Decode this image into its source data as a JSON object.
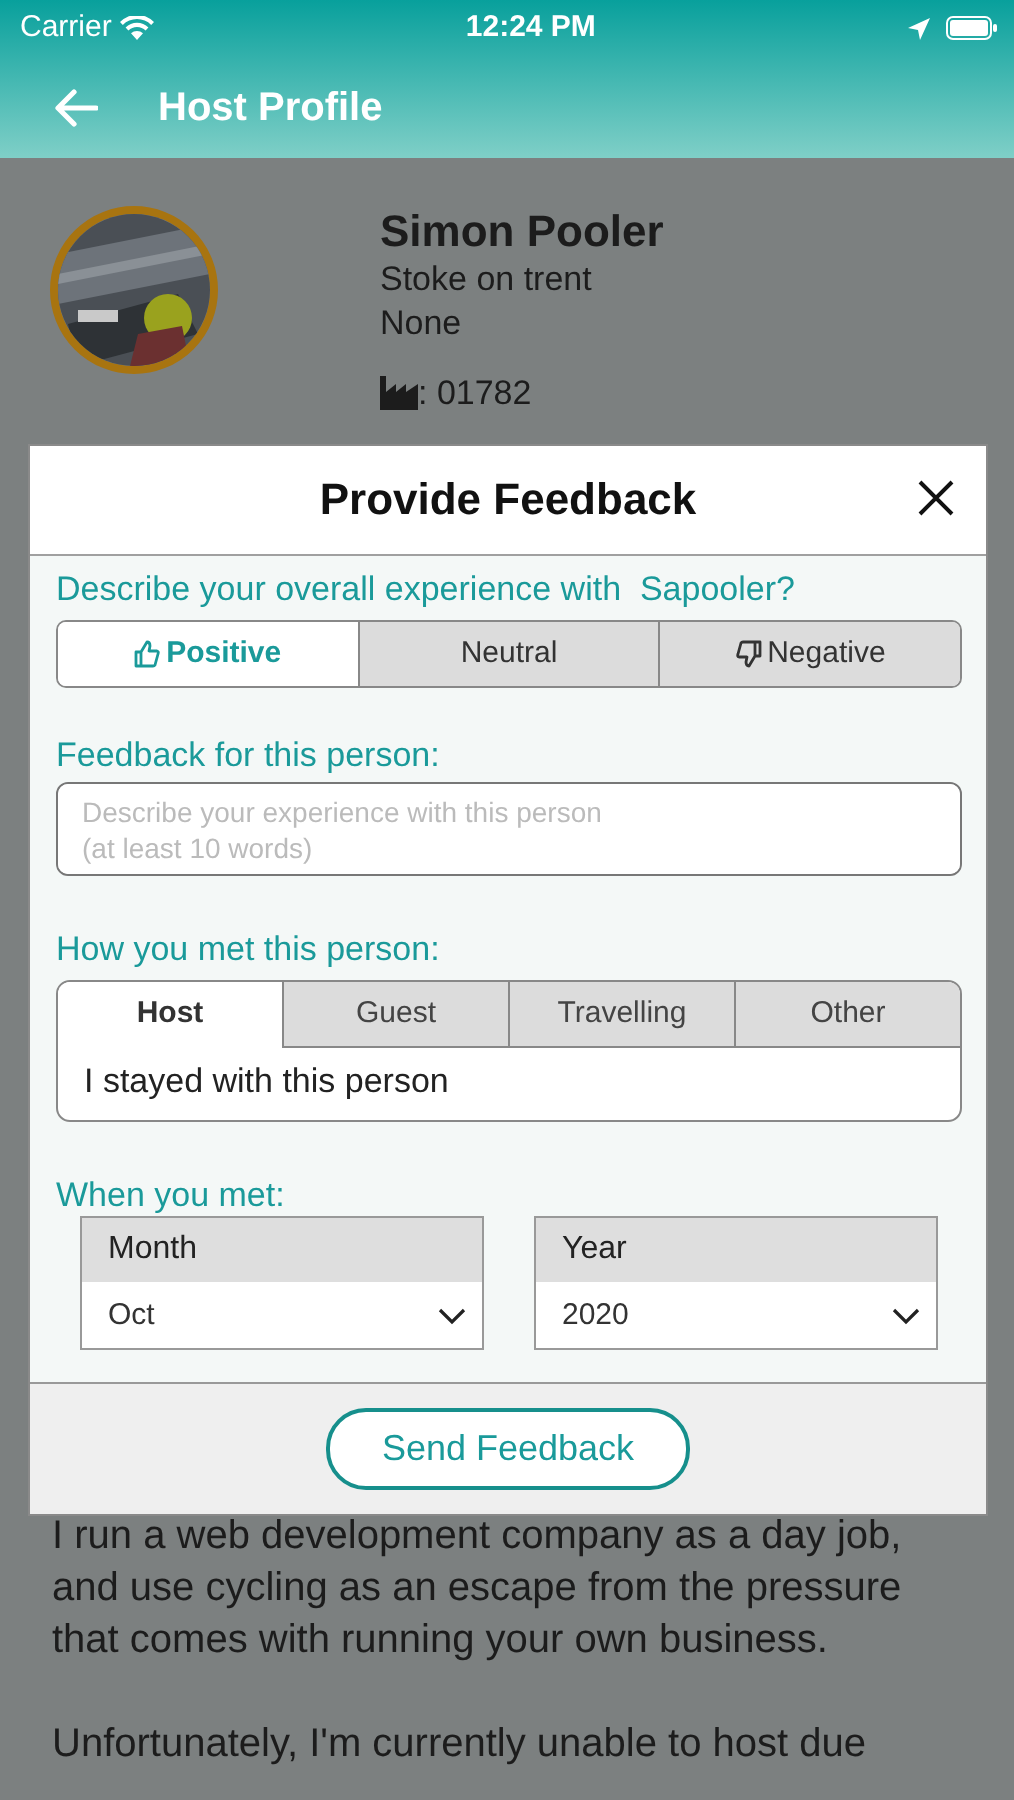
{
  "status_bar": {
    "carrier": "Carrier",
    "time": "12:24 PM"
  },
  "header": {
    "title": "Host Profile"
  },
  "profile": {
    "name": "Simon Pooler",
    "city": "Stoke on trent",
    "detail": "None",
    "phone": ": 01782"
  },
  "bio": [
    "I run a web development company as a day job, and use cycling as an escape from the pressure that comes with running your own business.",
    "Unfortunately, I'm currently unable to host due"
  ],
  "modal": {
    "title": "Provide Feedback",
    "question": "Describe your overall experience with  Sapooler?",
    "ratings": [
      {
        "label": "Positive",
        "kind": "up",
        "selected": true
      },
      {
        "label": "Neutral",
        "kind": "none",
        "selected": false
      },
      {
        "label": "Negative",
        "kind": "down",
        "selected": false
      }
    ],
    "feedback_label": "Feedback for this person:",
    "feedback_placeholder": "Describe your experience with this person\n(at least 10 words)",
    "met_label": "How you met this person:",
    "met_tabs": [
      {
        "label": "Host",
        "selected": true
      },
      {
        "label": "Guest",
        "selected": false
      },
      {
        "label": "Travelling",
        "selected": false
      },
      {
        "label": "Other",
        "selected": false
      }
    ],
    "met_description": "I stayed with this person",
    "when_label": "When you met:",
    "month": {
      "label": "Month",
      "value": "Oct"
    },
    "year": {
      "label": "Year",
      "value": "2020"
    },
    "send_button": "Send Feedback"
  }
}
